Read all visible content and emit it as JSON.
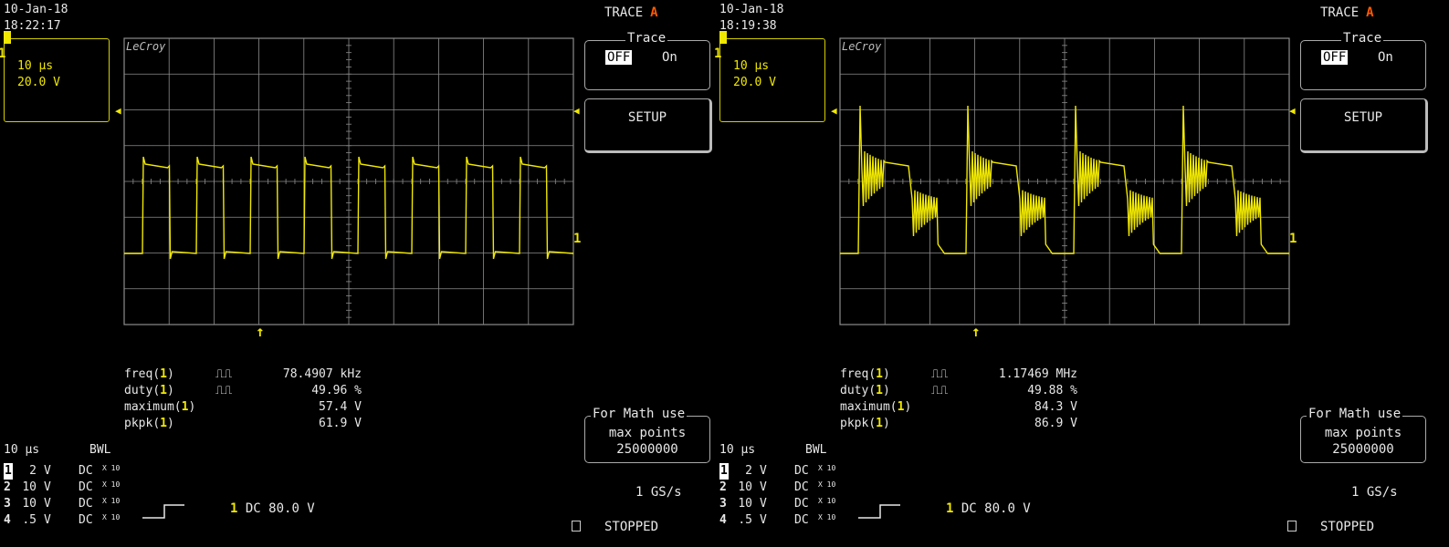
{
  "colors": {
    "trace": "#f0e800",
    "grid": "#8c8c8c",
    "accent": "#ff5a00",
    "text": "#e8e8e8"
  },
  "scopes": [
    {
      "date": "10-Jan-18",
      "time": "18:22:17",
      "timebase": {
        "channel": "1",
        "time_div": "10 µs",
        "volt_div": "20.0 V"
      },
      "trace_label": "TRACE",
      "trace_id": "A",
      "trace_menu": {
        "title": "Trace",
        "off": "OFF",
        "on": "On"
      },
      "setup_label": "SETUP",
      "brand": "LeCroy",
      "channel_marker": "1",
      "measurements": [
        {
          "name": "freq",
          "ch": "1",
          "glyph": "⎍⎍",
          "value": "78.4907 kHz"
        },
        {
          "name": "duty",
          "ch": "1",
          "glyph": "⎍⎍",
          "value": "49.96 %"
        },
        {
          "name": "maximum",
          "ch": "1",
          "glyph": "",
          "value": "57.4 V"
        },
        {
          "name": "pkpk",
          "ch": "1",
          "glyph": "",
          "value": "61.9 V"
        }
      ],
      "math_box": {
        "title": "For Math use",
        "line1": "max points",
        "line2": "25000000"
      },
      "channel_header": {
        "time": "10 µs",
        "bwl": "BWL"
      },
      "channels": [
        {
          "n": "1",
          "v": "2",
          "u": "V",
          "c": "DC",
          "x": "X 10"
        },
        {
          "n": "2",
          "v": "10",
          "u": "V",
          "c": "DC",
          "x": "X 10"
        },
        {
          "n": "3",
          "v": "10",
          "u": "V",
          "c": "DC",
          "x": "X 10"
        },
        {
          "n": "4",
          "v": ".5",
          "u": "V",
          "c": "DC",
          "x": "X 10"
        }
      ],
      "trigger": {
        "ch": "1",
        "text": "DC 80.0 V"
      },
      "sample_rate": "1 GS/s",
      "status": "STOPPED",
      "waveform": {
        "kind": "square",
        "cycles": 8,
        "ringing": false
      }
    },
    {
      "date": "10-Jan-18",
      "time": "18:19:38",
      "timebase": {
        "channel": "1",
        "time_div": "10 µs",
        "volt_div": "20.0 V"
      },
      "trace_label": "TRACE",
      "trace_id": "A",
      "trace_menu": {
        "title": "Trace",
        "off": "OFF",
        "on": "On"
      },
      "setup_label": "SETUP",
      "brand": "LeCroy",
      "channel_marker": "1",
      "measurements": [
        {
          "name": "freq",
          "ch": "1",
          "glyph": "⎍⎍",
          "value": "1.17469 MHz"
        },
        {
          "name": "duty",
          "ch": "1",
          "glyph": "⎍⎍",
          "value": "49.88 %"
        },
        {
          "name": "maximum",
          "ch": "1",
          "glyph": "",
          "value": "84.3 V"
        },
        {
          "name": "pkpk",
          "ch": "1",
          "glyph": "",
          "value": "86.9 V"
        }
      ],
      "math_box": {
        "title": "For Math use",
        "line1": "max points",
        "line2": "25000000"
      },
      "channel_header": {
        "time": "10 µs",
        "bwl": "BWL"
      },
      "channels": [
        {
          "n": "1",
          "v": "2",
          "u": "V",
          "c": "DC",
          "x": "X 10"
        },
        {
          "n": "2",
          "v": "10",
          "u": "V",
          "c": "DC",
          "x": "X 10"
        },
        {
          "n": "3",
          "v": "10",
          "u": "V",
          "c": "DC",
          "x": "X 10"
        },
        {
          "n": "4",
          "v": ".5",
          "u": "V",
          "c": "DC",
          "x": "X 10"
        }
      ],
      "trigger": {
        "ch": "1",
        "text": "DC 80.0 V"
      },
      "sample_rate": "1 GS/s",
      "status": "STOPPED",
      "waveform": {
        "kind": "square",
        "cycles": 4,
        "ringing": true
      }
    }
  ]
}
